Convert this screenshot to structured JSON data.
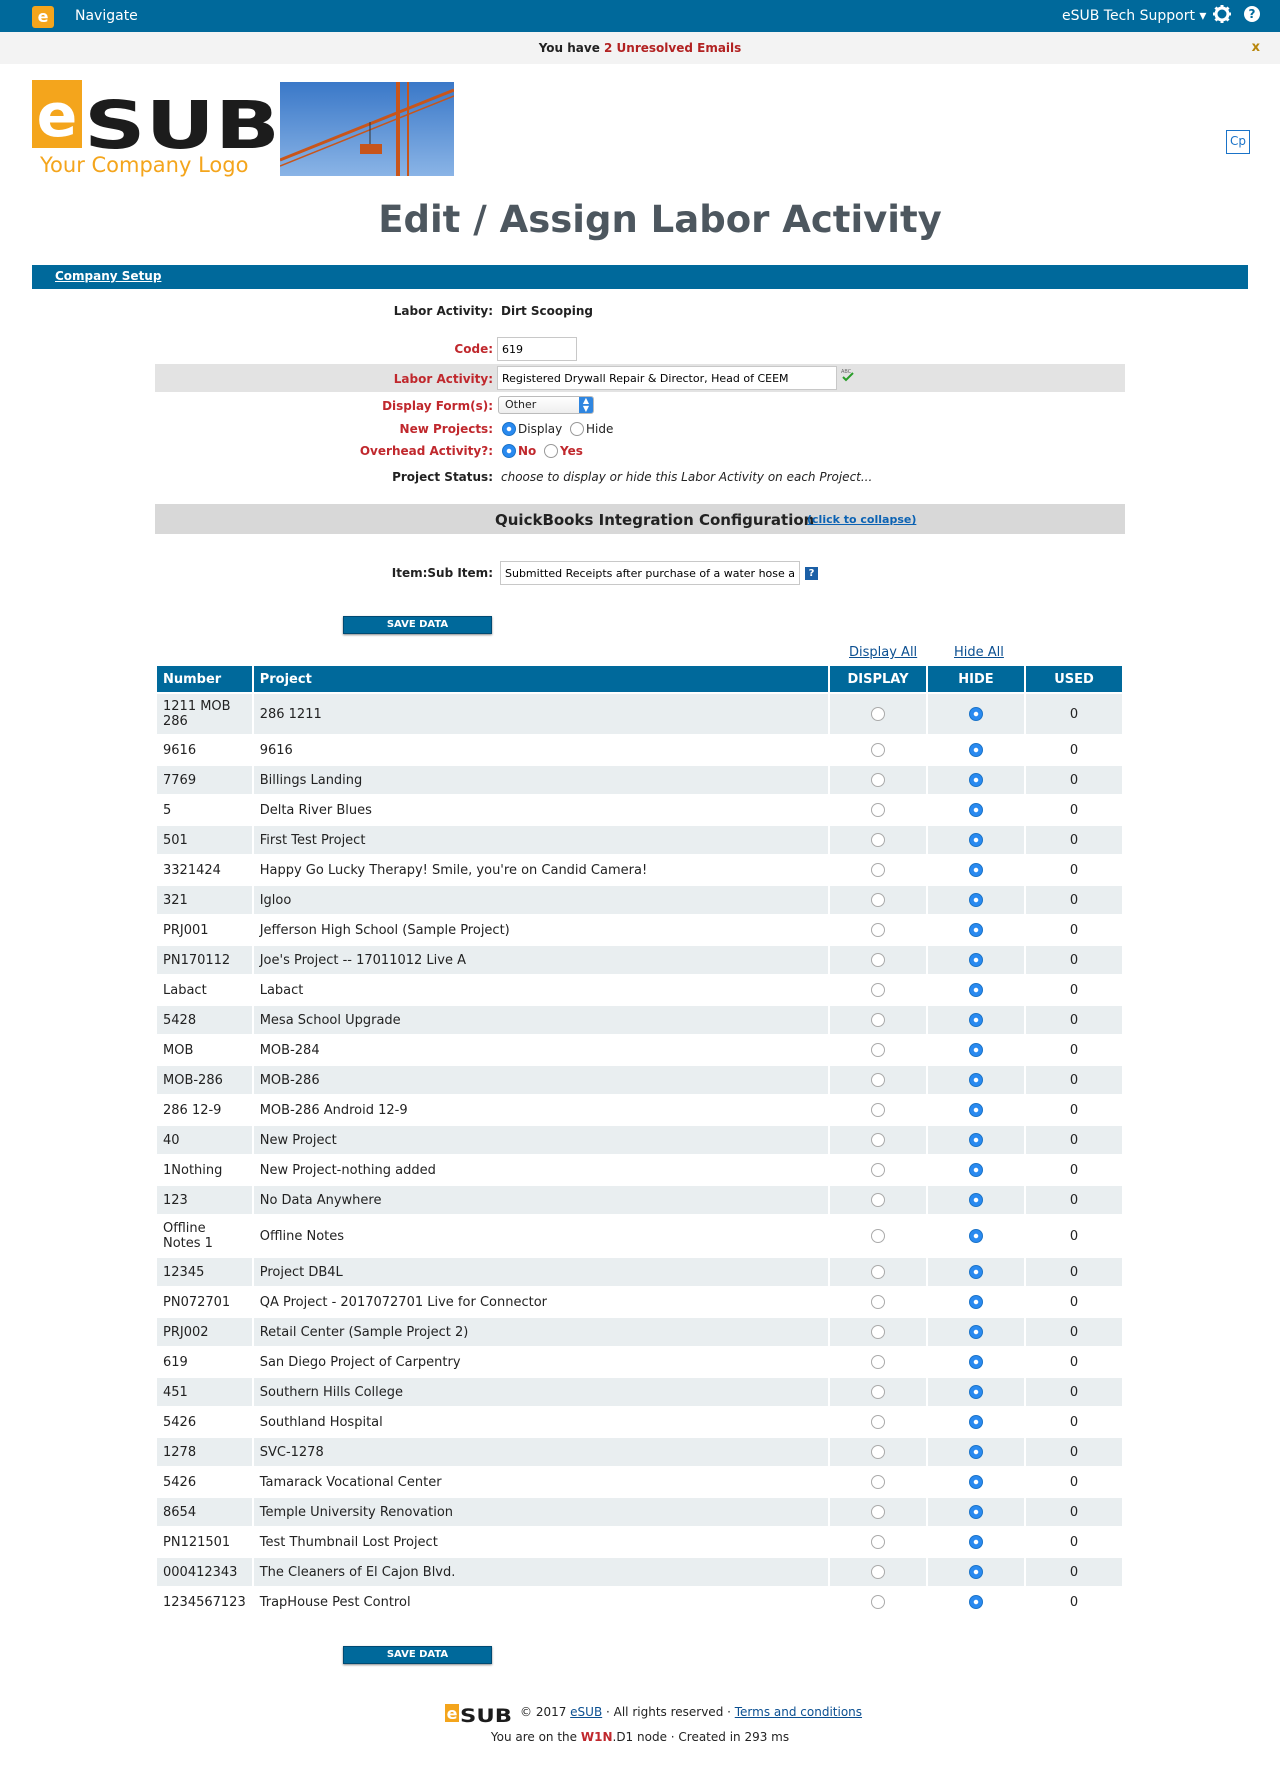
{
  "topbar": {
    "nav_label": "Navigate",
    "support_label": "eSUB Tech Support ▾",
    "help_label": "?"
  },
  "notice": {
    "prefix": "You have ",
    "highlight": "2 Unresolved Emails",
    "close": "x"
  },
  "logo": {
    "brand_e": "e",
    "brand_sub": "SUB",
    "tagline": "Your Company Logo",
    "cp_label": "Cp"
  },
  "page_title": "Edit / Assign Labor Activity",
  "section_link": "Company Setup",
  "form": {
    "labor_activity_label": "Labor Activity:",
    "labor_activity_value": "Dirt Scooping",
    "code_label": "Code:",
    "code_value": "619",
    "labor_activity_edit_label": "Labor Activity:",
    "labor_activity_edit_value": "Registered Drywall Repair & Director, Head of CEEM",
    "display_forms_label": "Display Form(s):",
    "display_forms_value": "Other",
    "new_projects_label": "New Projects:",
    "new_projects_opt1": "Display",
    "new_projects_opt2": "Hide",
    "overhead_label": "Overhead Activity?:",
    "overhead_opt1": "No",
    "overhead_opt2": "Yes",
    "project_status_label": "Project Status:",
    "project_status_value": "choose to display or hide this Labor Activity on each Project..."
  },
  "quickbooks": {
    "title": "QuickBooks Integration Configuration",
    "collapse": "(click to collapse)",
    "item_label": "Item:Sub Item:",
    "item_value": "Submitted Receipts after purchase of a water hose and Sand",
    "help": "?"
  },
  "save_label": "SAVE DATA",
  "display_all": "Display All",
  "hide_all": "Hide All",
  "table": {
    "headers": [
      "Number",
      "Project",
      "DISPLAY",
      "HIDE",
      "USED"
    ],
    "rows": [
      {
        "number": "1211 MOB 286",
        "project": "286 1211",
        "used": "0"
      },
      {
        "number": "9616",
        "project": "9616",
        "used": "0"
      },
      {
        "number": "7769",
        "project": "Billings Landing",
        "used": "0"
      },
      {
        "number": "5",
        "project": "Delta River Blues",
        "used": "0"
      },
      {
        "number": "501",
        "project": "First Test Project",
        "used": "0"
      },
      {
        "number": "3321424",
        "project": "Happy Go Lucky Therapy! Smile, you're on Candid Camera!",
        "used": "0"
      },
      {
        "number": "321",
        "project": "Igloo",
        "used": "0"
      },
      {
        "number": "PRJ001",
        "project": "Jefferson High School (Sample Project)",
        "used": "0"
      },
      {
        "number": "PN170112",
        "project": "Joe's Project -- 17011012 Live A",
        "used": "0"
      },
      {
        "number": "Labact",
        "project": "Labact",
        "used": "0"
      },
      {
        "number": "5428",
        "project": "Mesa School Upgrade",
        "used": "0"
      },
      {
        "number": "MOB",
        "project": "MOB-284",
        "used": "0"
      },
      {
        "number": "MOB-286",
        "project": "MOB-286",
        "used": "0"
      },
      {
        "number": "286 12-9",
        "project": "MOB-286 Android 12-9",
        "used": "0"
      },
      {
        "number": "40",
        "project": "New Project",
        "used": "0"
      },
      {
        "number": "1Nothing",
        "project": "New Project-nothing added",
        "used": "0"
      },
      {
        "number": "123",
        "project": "No Data Anywhere",
        "used": "0"
      },
      {
        "number": "Offline Notes 1",
        "project": "Offline Notes",
        "used": "0"
      },
      {
        "number": "12345",
        "project": "Project DB4L",
        "used": "0"
      },
      {
        "number": "PN072701",
        "project": "QA Project - 2017072701 Live for Connector",
        "used": "0"
      },
      {
        "number": "PRJ002",
        "project": "Retail Center (Sample Project 2)",
        "used": "0"
      },
      {
        "number": "619",
        "project": "San Diego Project of Carpentry",
        "used": "0"
      },
      {
        "number": "451",
        "project": "Southern Hills College",
        "used": "0"
      },
      {
        "number": "5426",
        "project": "Southland Hospital",
        "used": "0"
      },
      {
        "number": "1278",
        "project": "SVC-1278",
        "used": "0"
      },
      {
        "number": "5426",
        "project": "Tamarack Vocational Center",
        "used": "0"
      },
      {
        "number": "8654",
        "project": "Temple University Renovation",
        "used": "0"
      },
      {
        "number": "PN121501",
        "project": "Test Thumbnail Lost Project",
        "used": "0"
      },
      {
        "number": "000412343",
        "project": "The Cleaners of El Cajon Blvd.",
        "used": "0"
      },
      {
        "number": "1234567123",
        "project": "TrapHouse Pest Control",
        "used": "0"
      }
    ]
  },
  "footer": {
    "logo_e": "e",
    "logo_sub": "SUB",
    "copyright": "© 2017 ",
    "esub_link": "eSUB",
    "rights": " · All rights reserved · ",
    "terms": "Terms and conditions",
    "node_prefix": "You are on the ",
    "node_red": "W1N",
    "node_rest": ".D1 node ·  Created in 293 ms"
  },
  "colors": {
    "brand_blue": "#00699b",
    "accent_orange": "#f4a51c",
    "label_red": "#c0282d"
  }
}
